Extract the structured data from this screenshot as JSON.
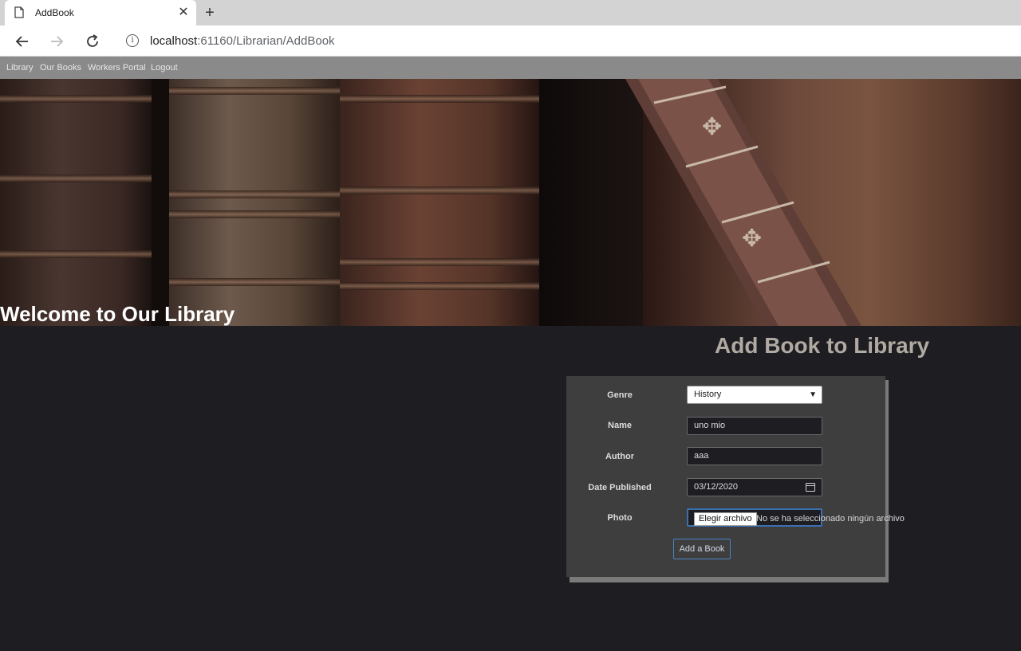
{
  "browser": {
    "tab_title": "AddBook",
    "url_host": "localhost",
    "url_rest": ":61160/Librarian/AddBook"
  },
  "site_nav": {
    "items": [
      "Library",
      "Our Books",
      "Workers Portal",
      "Logout"
    ]
  },
  "hero": {
    "title": "Welcome to Our Library"
  },
  "form": {
    "heading": "Add Book to Library",
    "genre_label": "Genre",
    "genre_value": "History",
    "name_label": "Name",
    "name_value": "uno mio",
    "author_label": "Author",
    "author_value": "aaa",
    "date_label": "Date Published",
    "date_value": "03/12/2020",
    "photo_label": "Photo",
    "choose_file_label": "Elegir archivo",
    "file_status": "No se ha seleccionado ningún archivo",
    "submit_label": "Add a Book"
  },
  "colors": {
    "page_background": "#1e1d22",
    "panel_background": "#3e3e3e",
    "nav_background": "#8a8a8a",
    "focus_border": "#3b6fb0"
  }
}
